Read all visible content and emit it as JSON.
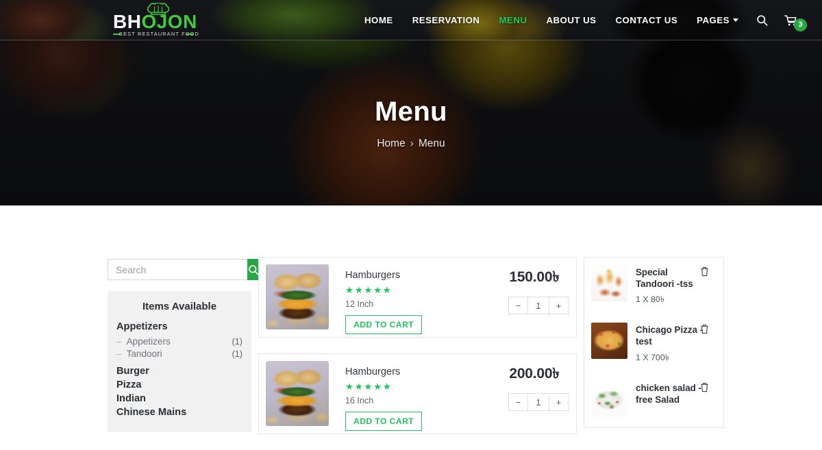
{
  "site": {
    "logo_main_light": "BH",
    "logo_main_accent": "OJON",
    "logo_tagline": "BEST RESTAURANT FOOD",
    "accent_green": "#28a745",
    "nav_active_green": "#22c55e"
  },
  "nav": {
    "items": [
      {
        "label": "HOME",
        "active": false
      },
      {
        "label": "RESERVATION",
        "active": false
      },
      {
        "label": "MENU",
        "active": true
      },
      {
        "label": "ABOUT US",
        "active": false
      },
      {
        "label": "CONTACT US",
        "active": false
      },
      {
        "label": "PAGES",
        "active": false,
        "has_dropdown": true
      }
    ],
    "search_icon": "search-icon",
    "cart_icon": "shopping-cart-icon",
    "cart_badge_count": "3"
  },
  "hero": {
    "title": "Menu",
    "breadcrumb_home": "Home",
    "breadcrumb_separator": "›",
    "breadcrumb_current": "Menu"
  },
  "sidebar": {
    "search_placeholder": "Search",
    "search_value": "",
    "search_button_icon": "search-icon",
    "panel_title": "Items Available",
    "categories": [
      {
        "label": "Appetizers",
        "subitems": [
          {
            "label": "Appetizers",
            "count": "(1)"
          },
          {
            "label": "Tandoori",
            "count": "(1)"
          }
        ]
      },
      {
        "label": "Burger",
        "subitems": []
      },
      {
        "label": "Pizza",
        "subitems": []
      },
      {
        "label": "Indian",
        "subitems": []
      },
      {
        "label": "Chinese Mains",
        "subitems": []
      }
    ]
  },
  "products": {
    "add_to_cart_label": "ADD TO CART",
    "rating_stars": "★★★★★",
    "minus_label": "−",
    "plus_label": "+",
    "items": [
      {
        "name": "Hamburgers",
        "size": "12 Inch",
        "price": "150.00৳",
        "quantity": "1",
        "image": "hamburger-photo"
      },
      {
        "name": "Hamburgers",
        "size": "16 Inch",
        "price": "200.00৳",
        "quantity": "1",
        "image": "hamburger-photo"
      }
    ]
  },
  "cart_panel": {
    "remove_icon": "trash-icon",
    "items": [
      {
        "name": "Special Tandoori -tss",
        "qty_price": "1 X 80৳",
        "image": "tandoori-photo"
      },
      {
        "name": "Chicago Pizza - test",
        "qty_price": "1 X 700৳",
        "image": "pizza-photo"
      },
      {
        "name": "chicken salad - free Salad",
        "qty_price": "",
        "image": "salad-photo"
      }
    ]
  }
}
